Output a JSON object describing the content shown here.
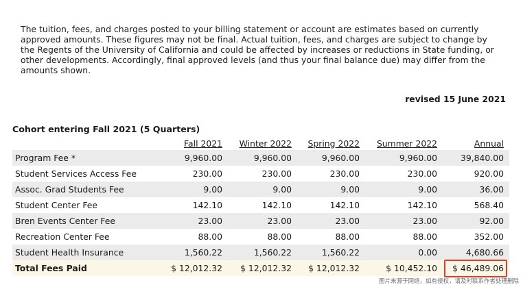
{
  "notice_text": "The tuition, fees, and charges posted to your billing statement or account are estimates based on currently approved amounts. These figures may not be final. Actual tuition, fees, and charges are subject to change by the Regents of the University of California and could be affected by increases or reductions in State funding, or other developments. Accordingly, final approved levels (and thus your final balance due) may differ from the amounts shown.",
  "revised": "revised 15 June 2021",
  "cohort_title": "Cohort entering Fall 2021 (5 Quarters)",
  "columns": [
    "Fall 2021",
    "Winter 2022",
    "Spring 2022",
    "Summer 2022",
    "Annual"
  ],
  "rows": [
    {
      "label": "Program Fee *",
      "values": [
        "9,960.00",
        "9,960.00",
        "9,960.00",
        "9,960.00",
        "39,840.00"
      ]
    },
    {
      "label": "Student Services Access Fee",
      "values": [
        "230.00",
        "230.00",
        "230.00",
        "230.00",
        "920.00"
      ]
    },
    {
      "label": "Assoc. Grad Students Fee",
      "values": [
        "9.00",
        "9.00",
        "9.00",
        "9.00",
        "36.00"
      ]
    },
    {
      "label": "Student Center Fee",
      "values": [
        "142.10",
        "142.10",
        "142.10",
        "142.10",
        "568.40"
      ]
    },
    {
      "label": "Bren Events Center Fee",
      "values": [
        "23.00",
        "23.00",
        "23.00",
        "23.00",
        "92.00"
      ]
    },
    {
      "label": "Recreation Center Fee",
      "values": [
        "88.00",
        "88.00",
        "88.00",
        "88.00",
        "352.00"
      ]
    },
    {
      "label": "Student Health Insurance",
      "values": [
        "1,560.22",
        "1,560.22",
        "1,560.22",
        "0.00",
        "4,680.66"
      ]
    }
  ],
  "total": {
    "label": "Total Fees Paid",
    "values": [
      "$ 12,012.32",
      "$ 12,012.32",
      "$ 12,012.32",
      "$ 10,452.10",
      "$ 46,489.06"
    ]
  },
  "watermark": "图片来源于网络，如有侵权，请及时联系作者处理删除",
  "highlight_color": "#e23a2c"
}
